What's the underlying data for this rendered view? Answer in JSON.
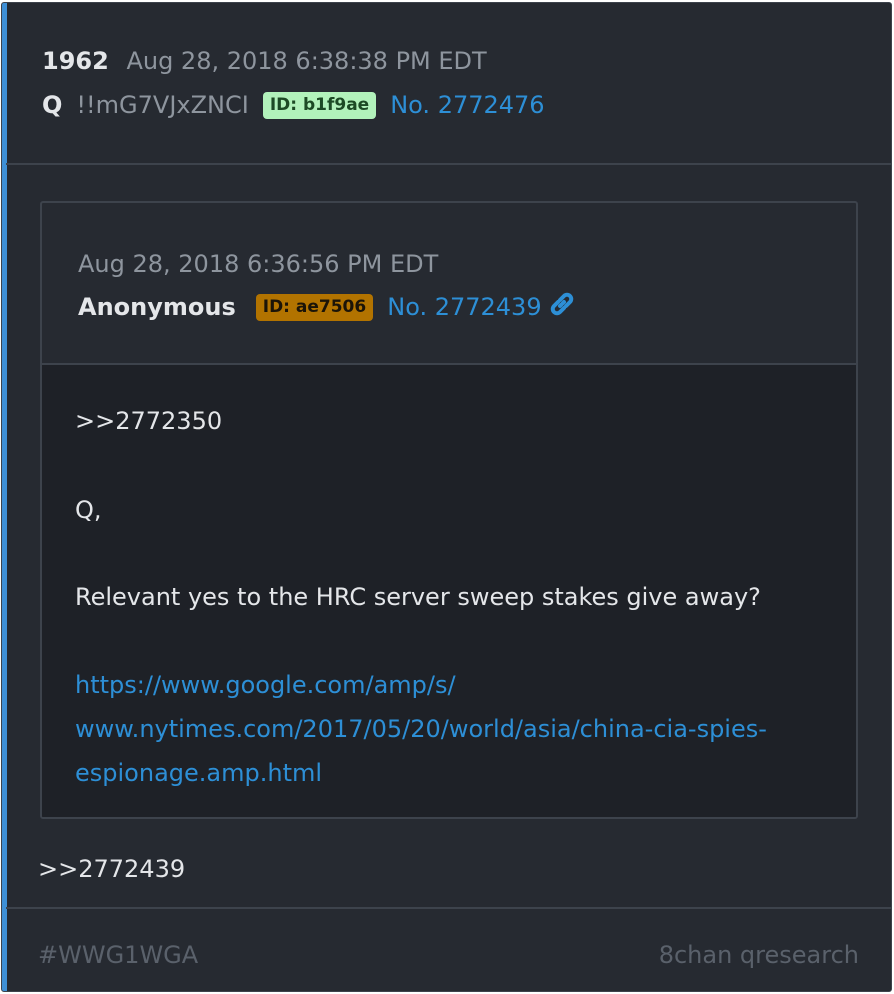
{
  "post": {
    "number": "1962",
    "timestamp": "Aug 28, 2018 6:38:38 PM EDT",
    "author": "Q",
    "tripcode": "!!mG7VJxZNCI",
    "id_badge": "ID: b1f9ae",
    "post_no": "No. 2772476",
    "reply_text": ">>2772439"
  },
  "quoted": {
    "timestamp": "Aug 28, 2018 6:36:56 PM EDT",
    "author": "Anonymous",
    "id_badge": "ID: ae7506",
    "post_no": "No. 2772439",
    "link_icon": "link-icon",
    "ref": ">>2772350",
    "greeting": "Q,",
    "question": "Relevant yes to the HRC server sweep stakes give away?",
    "url_lines": [
      "https://www.google.com/amp/s/",
      "www.nytimes.com/2017/05/20/world/asia/china-cia-spies-",
      "espionage.amp.html"
    ]
  },
  "footer": {
    "hashtag": "#WWG1WGA",
    "source": "8chan qresearch"
  },
  "colors": {
    "accent": "#3f90d6",
    "link": "#2d8fd6",
    "badge_green": "#b2f2bb",
    "badge_orange": "#b27300"
  }
}
